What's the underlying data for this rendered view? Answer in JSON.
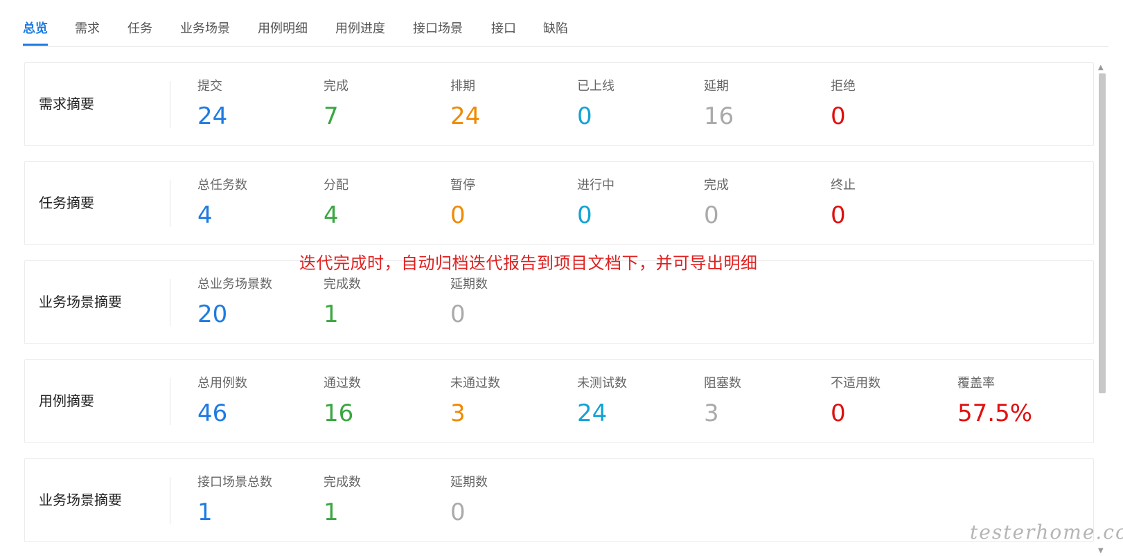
{
  "tabs": [
    {
      "label": "总览",
      "active": true
    },
    {
      "label": "需求"
    },
    {
      "label": "任务"
    },
    {
      "label": "业务场景"
    },
    {
      "label": "用例明细"
    },
    {
      "label": "用例进度"
    },
    {
      "label": "接口场景"
    },
    {
      "label": "接口"
    },
    {
      "label": "缺陷"
    }
  ],
  "cards": [
    {
      "title": "需求摘要",
      "stats": [
        {
          "label": "提交",
          "value": "24",
          "color": "#1e7be0"
        },
        {
          "label": "完成",
          "value": "7",
          "color": "#3aa640"
        },
        {
          "label": "排期",
          "value": "24",
          "color": "#f08a00"
        },
        {
          "label": "已上线",
          "value": "0",
          "color": "#12a3d6"
        },
        {
          "label": "延期",
          "value": "16",
          "color": "#aaaaaa"
        },
        {
          "label": "拒绝",
          "value": "0",
          "color": "#e01010"
        }
      ]
    },
    {
      "title": "任务摘要",
      "stats": [
        {
          "label": "总任务数",
          "value": "4",
          "color": "#1e7be0"
        },
        {
          "label": "分配",
          "value": "4",
          "color": "#3aa640"
        },
        {
          "label": "暂停",
          "value": "0",
          "color": "#f08a00"
        },
        {
          "label": "进行中",
          "value": "0",
          "color": "#12a3d6"
        },
        {
          "label": "完成",
          "value": "0",
          "color": "#aaaaaa"
        },
        {
          "label": "终止",
          "value": "0",
          "color": "#e01010"
        }
      ]
    },
    {
      "title": "业务场景摘要",
      "stats": [
        {
          "label": "总业务场景数",
          "value": "20",
          "color": "#1e7be0"
        },
        {
          "label": "完成数",
          "value": "1",
          "color": "#3aa640"
        },
        {
          "label": "延期数",
          "value": "0",
          "color": "#aaaaaa"
        }
      ]
    },
    {
      "title": "用例摘要",
      "stats": [
        {
          "label": "总用例数",
          "value": "46",
          "color": "#1e7be0"
        },
        {
          "label": "通过数",
          "value": "16",
          "color": "#3aa640"
        },
        {
          "label": "未通过数",
          "value": "3",
          "color": "#f08a00"
        },
        {
          "label": "未测试数",
          "value": "24",
          "color": "#12a3d6"
        },
        {
          "label": "阻塞数",
          "value": "3",
          "color": "#aaaaaa"
        },
        {
          "label": "不适用数",
          "value": "0",
          "color": "#e01010"
        },
        {
          "label": "覆盖率",
          "value": "57.5%",
          "color": "#e01010"
        }
      ]
    },
    {
      "title": "业务场景摘要",
      "stats": [
        {
          "label": "接口场景总数",
          "value": "1",
          "color": "#1e7be0"
        },
        {
          "label": "完成数",
          "value": "1",
          "color": "#3aa640"
        },
        {
          "label": "延期数",
          "value": "0",
          "color": "#aaaaaa"
        }
      ]
    }
  ],
  "annotation": "迭代完成时，自动归档迭代报告到项目文档下，并可导出明细",
  "watermark": "testerhome.com"
}
